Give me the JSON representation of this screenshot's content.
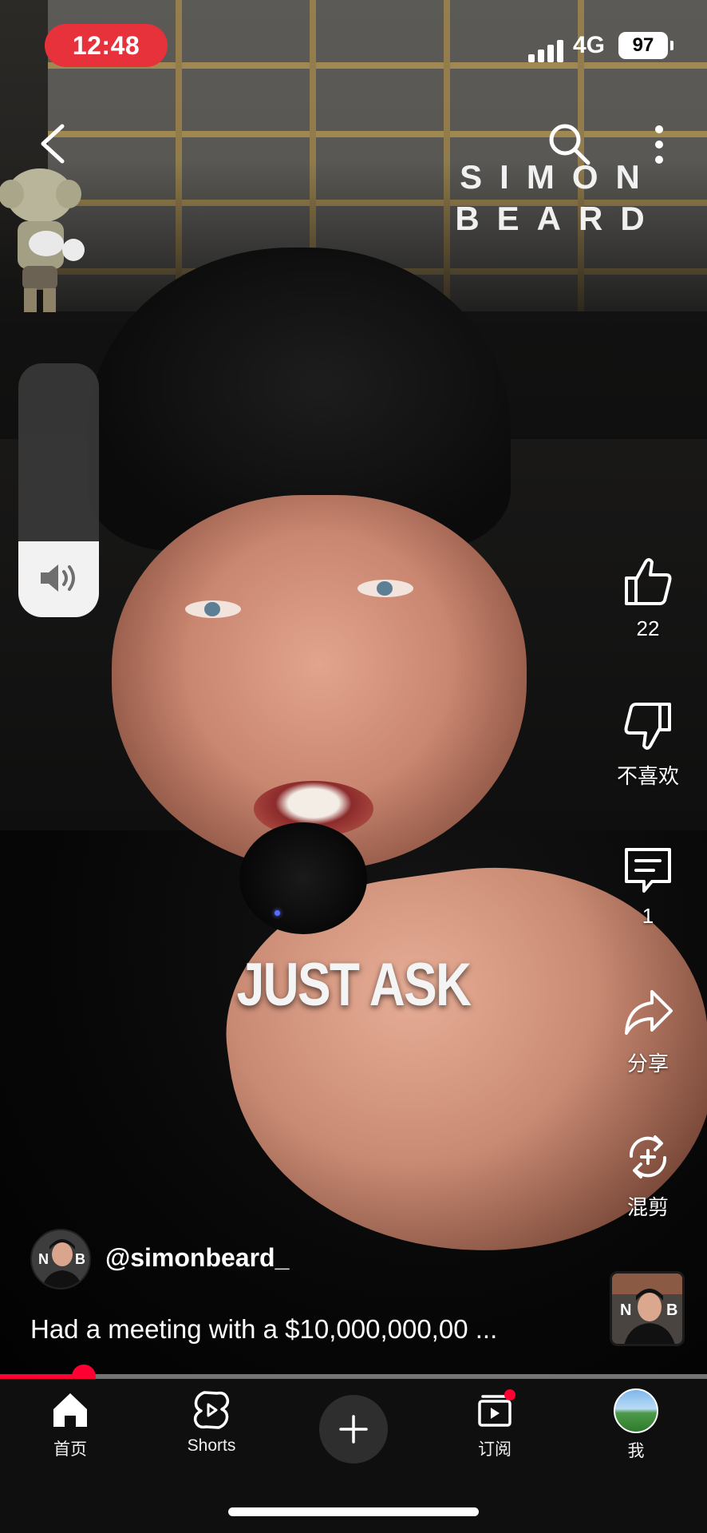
{
  "status_bar": {
    "time": "12:48",
    "network": "4G",
    "battery": "97",
    "time_pill_color": "#e8323b"
  },
  "top_bar": {
    "back_icon": "chevron-left-icon",
    "search_icon": "search-icon",
    "more_icon": "more-vertical-icon",
    "brand_line1": "SIMON",
    "brand_line2": "BEARD"
  },
  "volume": {
    "icon": "speaker-icon",
    "level": 0.3
  },
  "video": {
    "caption": "JUST ASK"
  },
  "actions": [
    {
      "name": "like",
      "icon": "thumbs-up-icon",
      "label": "22"
    },
    {
      "name": "dislike",
      "icon": "thumbs-down-icon",
      "label": "不喜欢"
    },
    {
      "name": "comments",
      "icon": "comment-icon",
      "label": "1"
    },
    {
      "name": "share",
      "icon": "share-icon",
      "label": "分享"
    },
    {
      "name": "remix",
      "icon": "remix-icon",
      "label": "混剪"
    }
  ],
  "channel": {
    "handle": "@simonbeard_",
    "avatar_text": "N B"
  },
  "video_title": "Had a meeting with a $10,000,000,00 ...",
  "progress": {
    "played_fraction": 0.118,
    "color": "#ff0033"
  },
  "nav": {
    "home": "首页",
    "shorts": "Shorts",
    "create_icon": "plus-icon",
    "subscriptions": "订阅",
    "me": "我",
    "notification_dot_color": "#ff0033"
  }
}
